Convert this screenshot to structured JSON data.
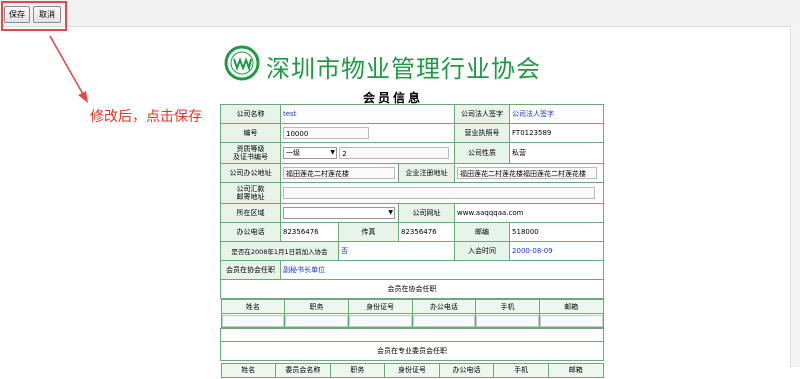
{
  "toolbar": {
    "save_label": "保存",
    "cancel_label": "取消"
  },
  "annotation": {
    "note": "修改后，点击保存"
  },
  "header": {
    "org_name": "深圳市物业管理行业协会",
    "page_title": "会员信息"
  },
  "form": {
    "company_name_label": "公司名称",
    "company_name": "test",
    "legal_sign_label": "公司法人签字",
    "legal_sign": "公司法人签字",
    "number_label": "编号",
    "number": "10000",
    "license_label": "营业执照号",
    "license": "FT0123589",
    "qual_label_1": "资质等级",
    "qual_label_2": "及证书编号",
    "qual_level": "一级",
    "qual_cert": "2",
    "nature_label": "公司性质",
    "nature": "私营",
    "office_addr_label": "公司办公地址",
    "office_addr": "福田莲花二村莲花楼",
    "reg_addr_label": "企业注册地址",
    "reg_addr": "福田莲花二村莲花楼福田莲花二村莲花楼",
    "remit_label_1": "公司汇款",
    "remit_label_2": "邮寄地址",
    "remit_addr": "",
    "district_label": "所在区域",
    "district": "",
    "website_label": "公司网址",
    "website": "www.aaqqqaa.com",
    "office_phone_label": "办公电话",
    "office_phone": "82356476",
    "fax_label": "传真",
    "fax": "82356476",
    "postcode_label": "邮编",
    "postcode": "518000",
    "joined_label": "是否在2008年1月1日前加入协会",
    "joined": "否",
    "join_time_label": "入会时间",
    "join_time": "2000-08-09",
    "position_label": "会员在协会任职",
    "position": "副秘书长单位"
  },
  "assoc_section": {
    "title": "会员在协会任职",
    "columns": [
      "姓名",
      "职务",
      "身份证号",
      "办公电话",
      "手机",
      "邮箱"
    ]
  },
  "committee_section": {
    "title": "会员在专业委员会任职",
    "columns": [
      "姓名",
      "委员会名称",
      "职务",
      "身份证号",
      "办公电话",
      "手机",
      "邮箱"
    ]
  },
  "colors": {
    "title_green": "#1e9a45",
    "note_red": "#e8322a",
    "link_blue": "#1a33c8",
    "border_green": "#6aa97a"
  },
  "icons": {
    "logo": "association-logo-icon",
    "dropdown": "chevron-down-icon"
  }
}
